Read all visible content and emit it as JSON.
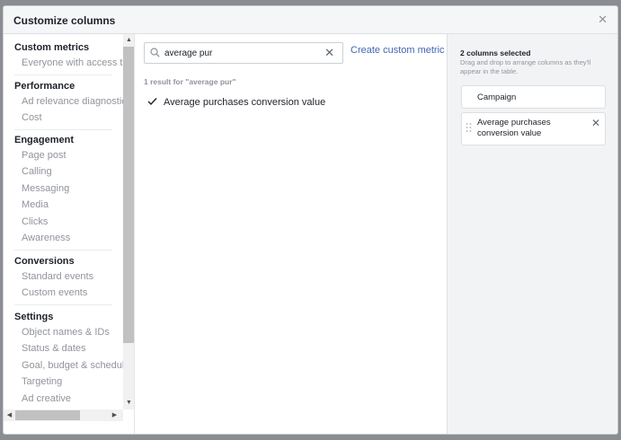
{
  "modal": {
    "title": "Customize columns",
    "close_icon": "close-icon"
  },
  "sidebar": {
    "groups": [
      {
        "header": "Custom metrics",
        "items": [
          "Everyone with access to"
        ]
      },
      {
        "header": "Performance",
        "items": [
          "Ad relevance diagnostics",
          "Cost"
        ]
      },
      {
        "header": "Engagement",
        "items": [
          "Page post",
          "Calling",
          "Messaging",
          "Media",
          "Clicks",
          "Awareness"
        ]
      },
      {
        "header": "Conversions",
        "items": [
          "Standard events",
          "Custom events"
        ]
      },
      {
        "header": "Settings",
        "items": [
          "Object names & IDs",
          "Status & dates",
          "Goal, budget & schedule",
          "Targeting",
          "Ad creative"
        ]
      }
    ]
  },
  "search": {
    "value": "average pur",
    "create_link": "Create custom metric",
    "result_count": "1 result for \"average pur\"",
    "results": [
      "Average purchases conversion value"
    ]
  },
  "selected": {
    "title": "2 columns selected",
    "description": "Drag and drop to arrange columns as they'll appear in the table.",
    "columns": [
      "Campaign",
      "Average purchases conversion value"
    ]
  },
  "colors": {
    "link": "#4267b2",
    "panel_bg": "#f2f3f5",
    "muted": "#90949c"
  }
}
